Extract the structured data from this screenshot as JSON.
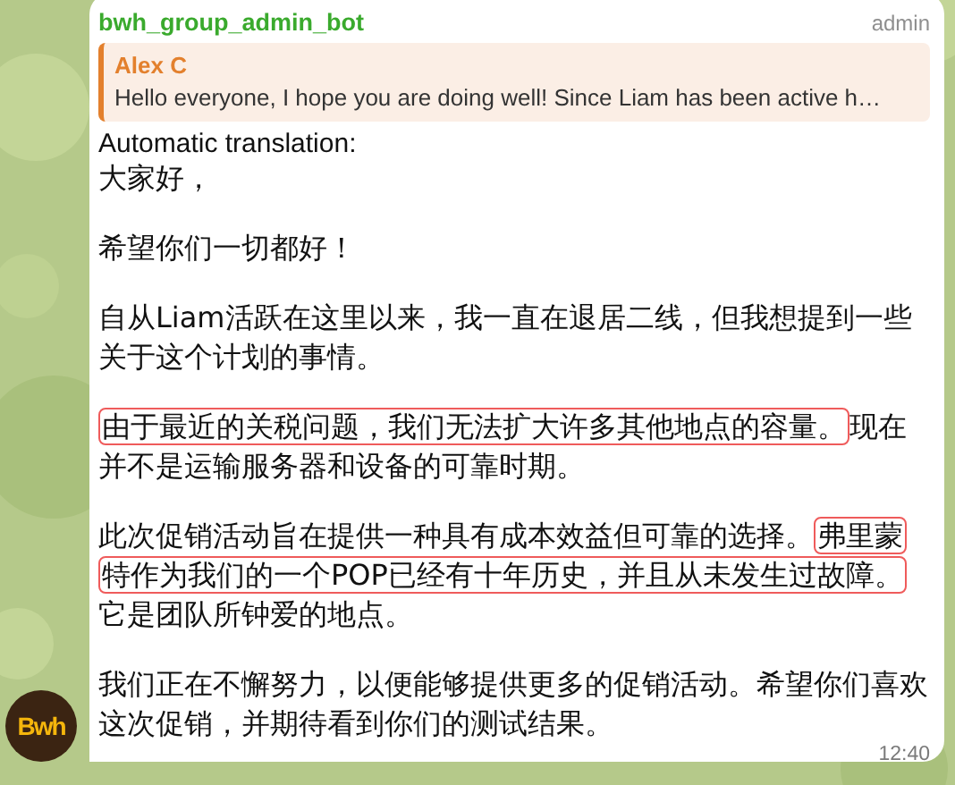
{
  "avatar": {
    "text": "Bwh"
  },
  "message": {
    "sender": "bwh_group_admin_bot",
    "role": "admin",
    "reply": {
      "author": "Alex C",
      "text": "Hello everyone, I hope you are doing well! Since Liam has been active h…"
    },
    "translation_label": "Automatic translation:",
    "paragraphs": [
      {
        "segments": [
          {
            "text": "大家好，",
            "highlighted": false
          }
        ]
      },
      {
        "segments": [
          {
            "text": "希望你们一切都好！",
            "highlighted": false
          }
        ]
      },
      {
        "segments": [
          {
            "text": "自从Liam活跃在这里以来，我一直在退居二线，但我想提到一些关于这个计划的事情。",
            "highlighted": false
          }
        ]
      },
      {
        "segments": [
          {
            "text": "由于最近的关税问题，我们无法扩大许多其他地点的容量。",
            "highlighted": true
          },
          {
            "text": "现在并不是运输服务器和设备的可靠时期。",
            "highlighted": false
          }
        ]
      },
      {
        "segments": [
          {
            "text": "此次促销活动旨在提供一种具有成本效益但可靠的选择。",
            "highlighted": false
          },
          {
            "text": "弗里蒙特作为我们的一个POP已经有十年历史，并且从未发生过故障。",
            "highlighted": true
          },
          {
            "text": "它是团队所钟爱的地点。",
            "highlighted": false
          }
        ]
      },
      {
        "segments": [
          {
            "text": "我们正在不懈努力，以便能够提供更多的促销活动。希望你们喜欢这次促销，并期待看到你们的测试结果。",
            "highlighted": false
          }
        ]
      }
    ],
    "time": "12:40"
  }
}
